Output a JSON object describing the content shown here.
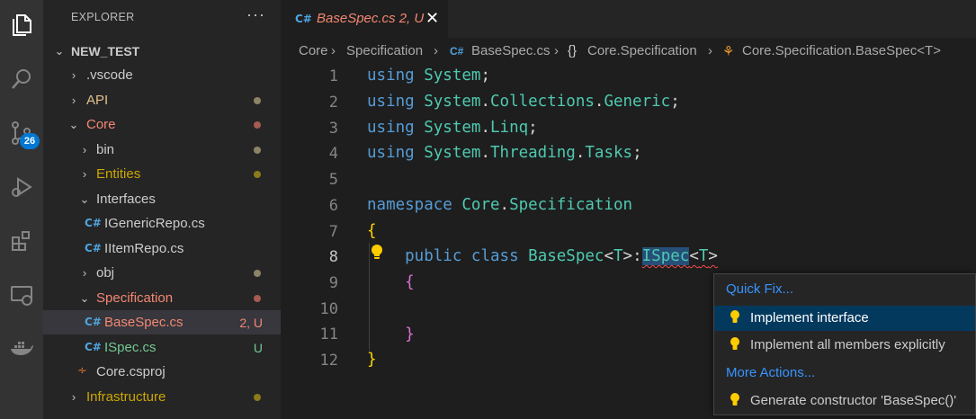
{
  "activity_bar": {
    "items": [
      "explorer-icon",
      "search-icon",
      "source-control-icon",
      "run-debug-icon",
      "extensions-icon",
      "remote-explorer-icon",
      "docker-icon"
    ],
    "source_control_badge": "26"
  },
  "sidebar": {
    "title": "EXPLORER",
    "more": "···",
    "root": "NEW_TEST",
    "items": [
      {
        "label": ".vscode"
      },
      {
        "label": "API"
      },
      {
        "label": "Core"
      },
      {
        "label": "bin"
      },
      {
        "label": "Entities"
      },
      {
        "label": "Interfaces"
      },
      {
        "label": "IGenericRepo.cs"
      },
      {
        "label": "IItemRepo.cs"
      },
      {
        "label": "obj"
      },
      {
        "label": "Specification"
      },
      {
        "label": "BaseSpec.cs",
        "status": "2, U"
      },
      {
        "label": "ISpec.cs",
        "status": "U"
      },
      {
        "label": "Core.csproj"
      },
      {
        "label": "Infrastructure"
      }
    ]
  },
  "tab": {
    "title": "BaseSpec.cs  2, U",
    "icon": "C#",
    "close": "✕"
  },
  "breadcrumb": {
    "items": [
      "Core",
      "Specification",
      "BaseSpec.cs",
      "Core.Specification",
      "Core.Specification.BaseSpec<T>"
    ],
    "sep": "›",
    "cs_icon": "C#",
    "ns_icon": "{}"
  },
  "editor": {
    "line_numbers": [
      "1",
      "2",
      "3",
      "4",
      "5",
      "6",
      "7",
      "8",
      "9",
      "10",
      "11",
      "12"
    ],
    "active_line": "8"
  },
  "quick_fix": {
    "header": "Quick Fix...",
    "items": [
      "Implement interface",
      "Implement all members explicitly"
    ],
    "more_header": "More Actions...",
    "more_items": [
      "Generate constructor 'BaseSpec()'"
    ]
  },
  "colors": {
    "accent": "#0078d4",
    "modified_dot": "#8a8a4a",
    "untracked_green": "#73c991",
    "error_red": "#f48771",
    "warning_yellow": "#cca700"
  }
}
